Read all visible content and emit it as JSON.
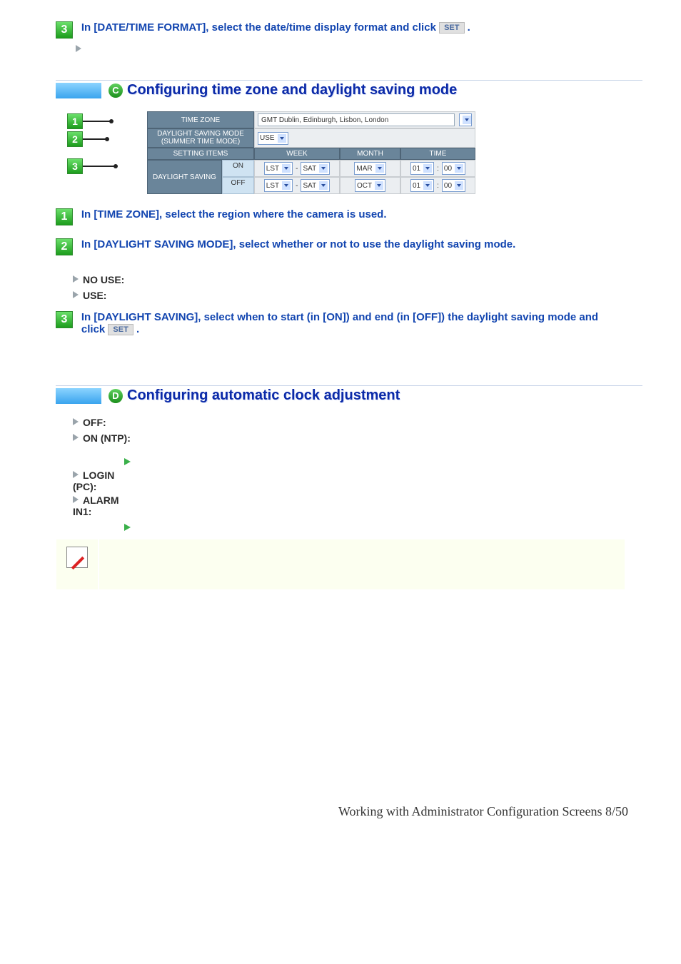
{
  "topStep": {
    "num": "3",
    "text_a": "In [DATE/TIME FORMAT], select the date/time display format and click ",
    "set": "SET",
    "text_b": " ."
  },
  "sectionC": {
    "letter": "C",
    "title": "Configuring time zone and daylight saving mode",
    "shot": {
      "row1_label": "TIME ZONE",
      "row1_value": "GMT Dublin, Edinburgh, Lisbon, London",
      "row2_label_a": "DAYLIGHT SAVING MODE",
      "row2_label_b": "(SUMMER TIME MODE)",
      "row2_value": "USE",
      "head_setting": "SETTING ITEMS",
      "head_week": "WEEK",
      "head_month": "MONTH",
      "head_time": "TIME",
      "row_ds_label": "DAYLIGHT SAVING",
      "on": "ON",
      "off": "OFF",
      "wk_a": "LST",
      "wk_b": "SAT",
      "mo_on": "MAR",
      "mo_off": "OCT",
      "tm_h": "01",
      "tm_m": "00"
    },
    "steps": {
      "s1": "In [TIME ZONE], select the region where the camera is used.",
      "s2": "In [DAYLIGHT SAVING MODE], select whether or not to use the daylight saving mode.",
      "nouse": "NO USE:",
      "use": "USE:",
      "s3_a": "In [DAYLIGHT SAVING], select when to start (in [ON]) and end (in [OFF]) the daylight saving mode and click ",
      "s3_set": "SET",
      "s3_b": " ."
    },
    "callouts": {
      "n1": "1",
      "n2": "2",
      "n3": "3"
    }
  },
  "sectionD": {
    "letter": "D",
    "title": "Configuring automatic clock adjustment",
    "items": {
      "off": "OFF:",
      "on_ntp": "ON (NTP):",
      "login": "LOGIN (PC):",
      "alarm": "ALARM IN1:"
    }
  },
  "footer": {
    "text": "Working with Administrator Configuration Screens 8/50"
  }
}
